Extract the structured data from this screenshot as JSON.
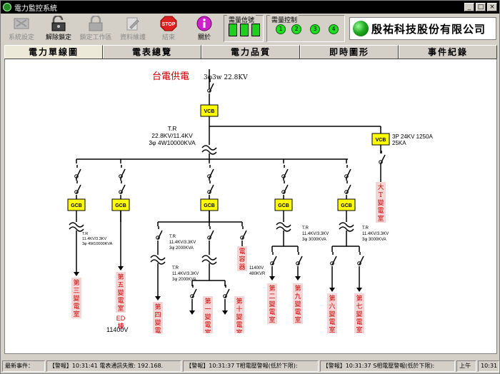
{
  "window": {
    "title": "電力監控系統",
    "controls": [
      "_",
      "□",
      "×"
    ]
  },
  "toolbar": {
    "buttons": [
      {
        "label": "系統設定",
        "icon": "settings-icon",
        "enabled": false
      },
      {
        "label": "解除鎖定",
        "icon": "unlock-icon",
        "enabled": true
      },
      {
        "label": "鎖定工作區",
        "icon": "lock-icon",
        "enabled": false
      },
      {
        "label": "資料維護",
        "icon": "data-maintenance-icon",
        "enabled": false
      },
      {
        "label": "結束",
        "icon": "stop-icon",
        "stop_text": "STOP",
        "enabled": false
      },
      {
        "label": "關於",
        "icon": "about-icon",
        "enabled": true
      }
    ],
    "demand_signal": {
      "label": "需量信號"
    },
    "demand_control": {
      "label": "需量控制",
      "leds": [
        "1",
        "2",
        "3",
        "4"
      ]
    },
    "company": "殷祐科技股份有限公司"
  },
  "tabs": [
    "電力單線圖",
    "電表總覽",
    "電力品質",
    "即時圖形",
    "事件紀錄"
  ],
  "diagram": {
    "source_label": "台電供電",
    "source_spec": "3φ3w 22.8KV",
    "main_tr": [
      "T.R",
      "22.8KV/11.4KV",
      "3φ 4W10000KVA"
    ],
    "vcb_right_spec": [
      "3P 24KV 1250A",
      "25KA"
    ],
    "vcb": "VCB",
    "gcb": "GCB",
    "tr_small_1": [
      "T.R",
      "11.4KV/3.3KV",
      "3φ 4W10000KVA"
    ],
    "tr_center": [
      "T.R",
      "11.4KV/3.3KV",
      "3φ 2000KVA"
    ],
    "tr_center_low": [
      "T.R",
      "11.4KV/3.3KV",
      "3φ 2000KVA"
    ],
    "tr_a": [
      "T.R",
      "11.4KV/3.3KV",
      "3φ 3000KVA"
    ],
    "tr_b": [
      "T.R",
      "11.4KV/3.3KV",
      "3φ 3000KVA"
    ],
    "cap_note": [
      "11400V",
      "480KVR"
    ],
    "voltage_note": "11400V",
    "loads": {
      "third": "第三變電室",
      "fifth": "第五變電室",
      "fifth_ext": "ED\n棟",
      "fourth": "第四變電室",
      "first": "第一變電室",
      "tenth": "第十變電室",
      "capacitor": "電容器",
      "second": "第二變電室",
      "ninth": "第九變電室",
      "sixth": "第六變電室",
      "seventh": "第七變電室",
      "big": "大T變電室"
    }
  },
  "statusbar": {
    "label": "最新事件：",
    "events": [
      "【警報】10:31:41 電表通訊失敗: 192.168.",
      "【警報】10:31:37 T相電壓警報(低於下限):",
      "【警報】10:31:37 S相電壓警報(低於下限):"
    ],
    "ampm": "上午",
    "clock": "10:31"
  },
  "colors": {
    "breaker_fill": "#ffff00",
    "load_label_bg": "#f4d6d6",
    "load_label_text": "#cc0000",
    "source_text": "#cc0000",
    "led_green": "#22dd22"
  }
}
